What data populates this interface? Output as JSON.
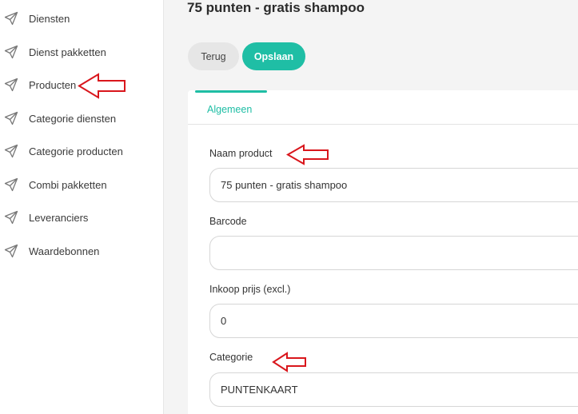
{
  "sidebar": {
    "items": [
      {
        "label": "Diensten",
        "icon": "send-icon"
      },
      {
        "label": "Dienst pakketten",
        "icon": "send-icon"
      },
      {
        "label": "Producten",
        "icon": "send-icon"
      },
      {
        "label": "Categorie diensten",
        "icon": "send-icon"
      },
      {
        "label": "Categorie producten",
        "icon": "send-icon"
      },
      {
        "label": "Combi pakketten",
        "icon": "send-icon"
      },
      {
        "label": "Leveranciers",
        "icon": "send-icon"
      },
      {
        "label": "Waardebonnen",
        "icon": "send-icon"
      }
    ]
  },
  "header": {
    "title": "75 punten - gratis shampoo"
  },
  "toolbar": {
    "back_label": "Terug",
    "save_label": "Opslaan"
  },
  "tabs": [
    {
      "label": "Algemeen",
      "active": true
    }
  ],
  "form": {
    "name": {
      "label": "Naam product",
      "value": "75 punten - gratis shampoo"
    },
    "barcode": {
      "label": "Barcode",
      "value": ""
    },
    "purchase_price": {
      "label": "Inkoop prijs (excl.)",
      "value": "0"
    },
    "category": {
      "label": "Categorie",
      "value": "PUNTENKAART"
    }
  },
  "colors": {
    "accent": "#1fbea5",
    "annotation": "#d9161c"
  }
}
